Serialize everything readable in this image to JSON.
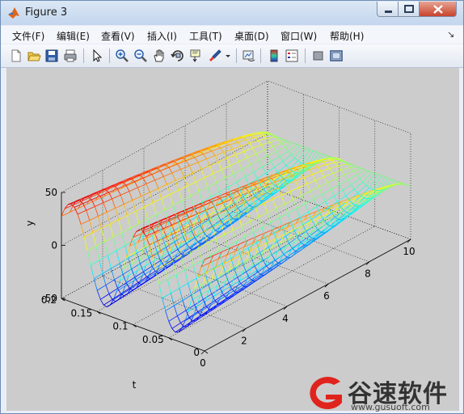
{
  "window": {
    "title": "Figure 3"
  },
  "menu": [
    "文件(F)",
    "编辑(E)",
    "查看(V)",
    "插入(I)",
    "工具(T)",
    "桌面(D)",
    "窗口(W)",
    "帮助(H)"
  ],
  "toolbar_icons": [
    "new-figure-icon",
    "open-file-icon",
    "save-icon",
    "print-icon",
    "select-arrow-icon",
    "zoom-in-icon",
    "zoom-out-icon",
    "pan-hand-icon",
    "rotate-3d-icon",
    "data-cursor-icon",
    "brush-icon",
    "brush-dropdown-icon",
    "link-plot-icon",
    "colorbar-icon",
    "legend-icon",
    "hide-plot-tools-icon",
    "show-plot-tools-icon"
  ],
  "watermark": {
    "text": "谷速软件",
    "url": "www.gusuoft.com"
  },
  "chart_data": {
    "type": "surface-mesh",
    "zlabel": "y",
    "ylabel": "t",
    "xlabel": "",
    "x_ticks": [
      "0",
      "2",
      "4",
      "6",
      "8",
      "10"
    ],
    "y_ticks": [
      "0",
      "0.05",
      "0.1",
      "0.15",
      "0.2"
    ],
    "z_ticks": [
      "-50",
      "0",
      "50"
    ],
    "xlim": [
      0,
      10
    ],
    "ylim": [
      0,
      0.2
    ],
    "zlim": [
      -50,
      50
    ],
    "grid": true,
    "colormap": "jet"
  }
}
